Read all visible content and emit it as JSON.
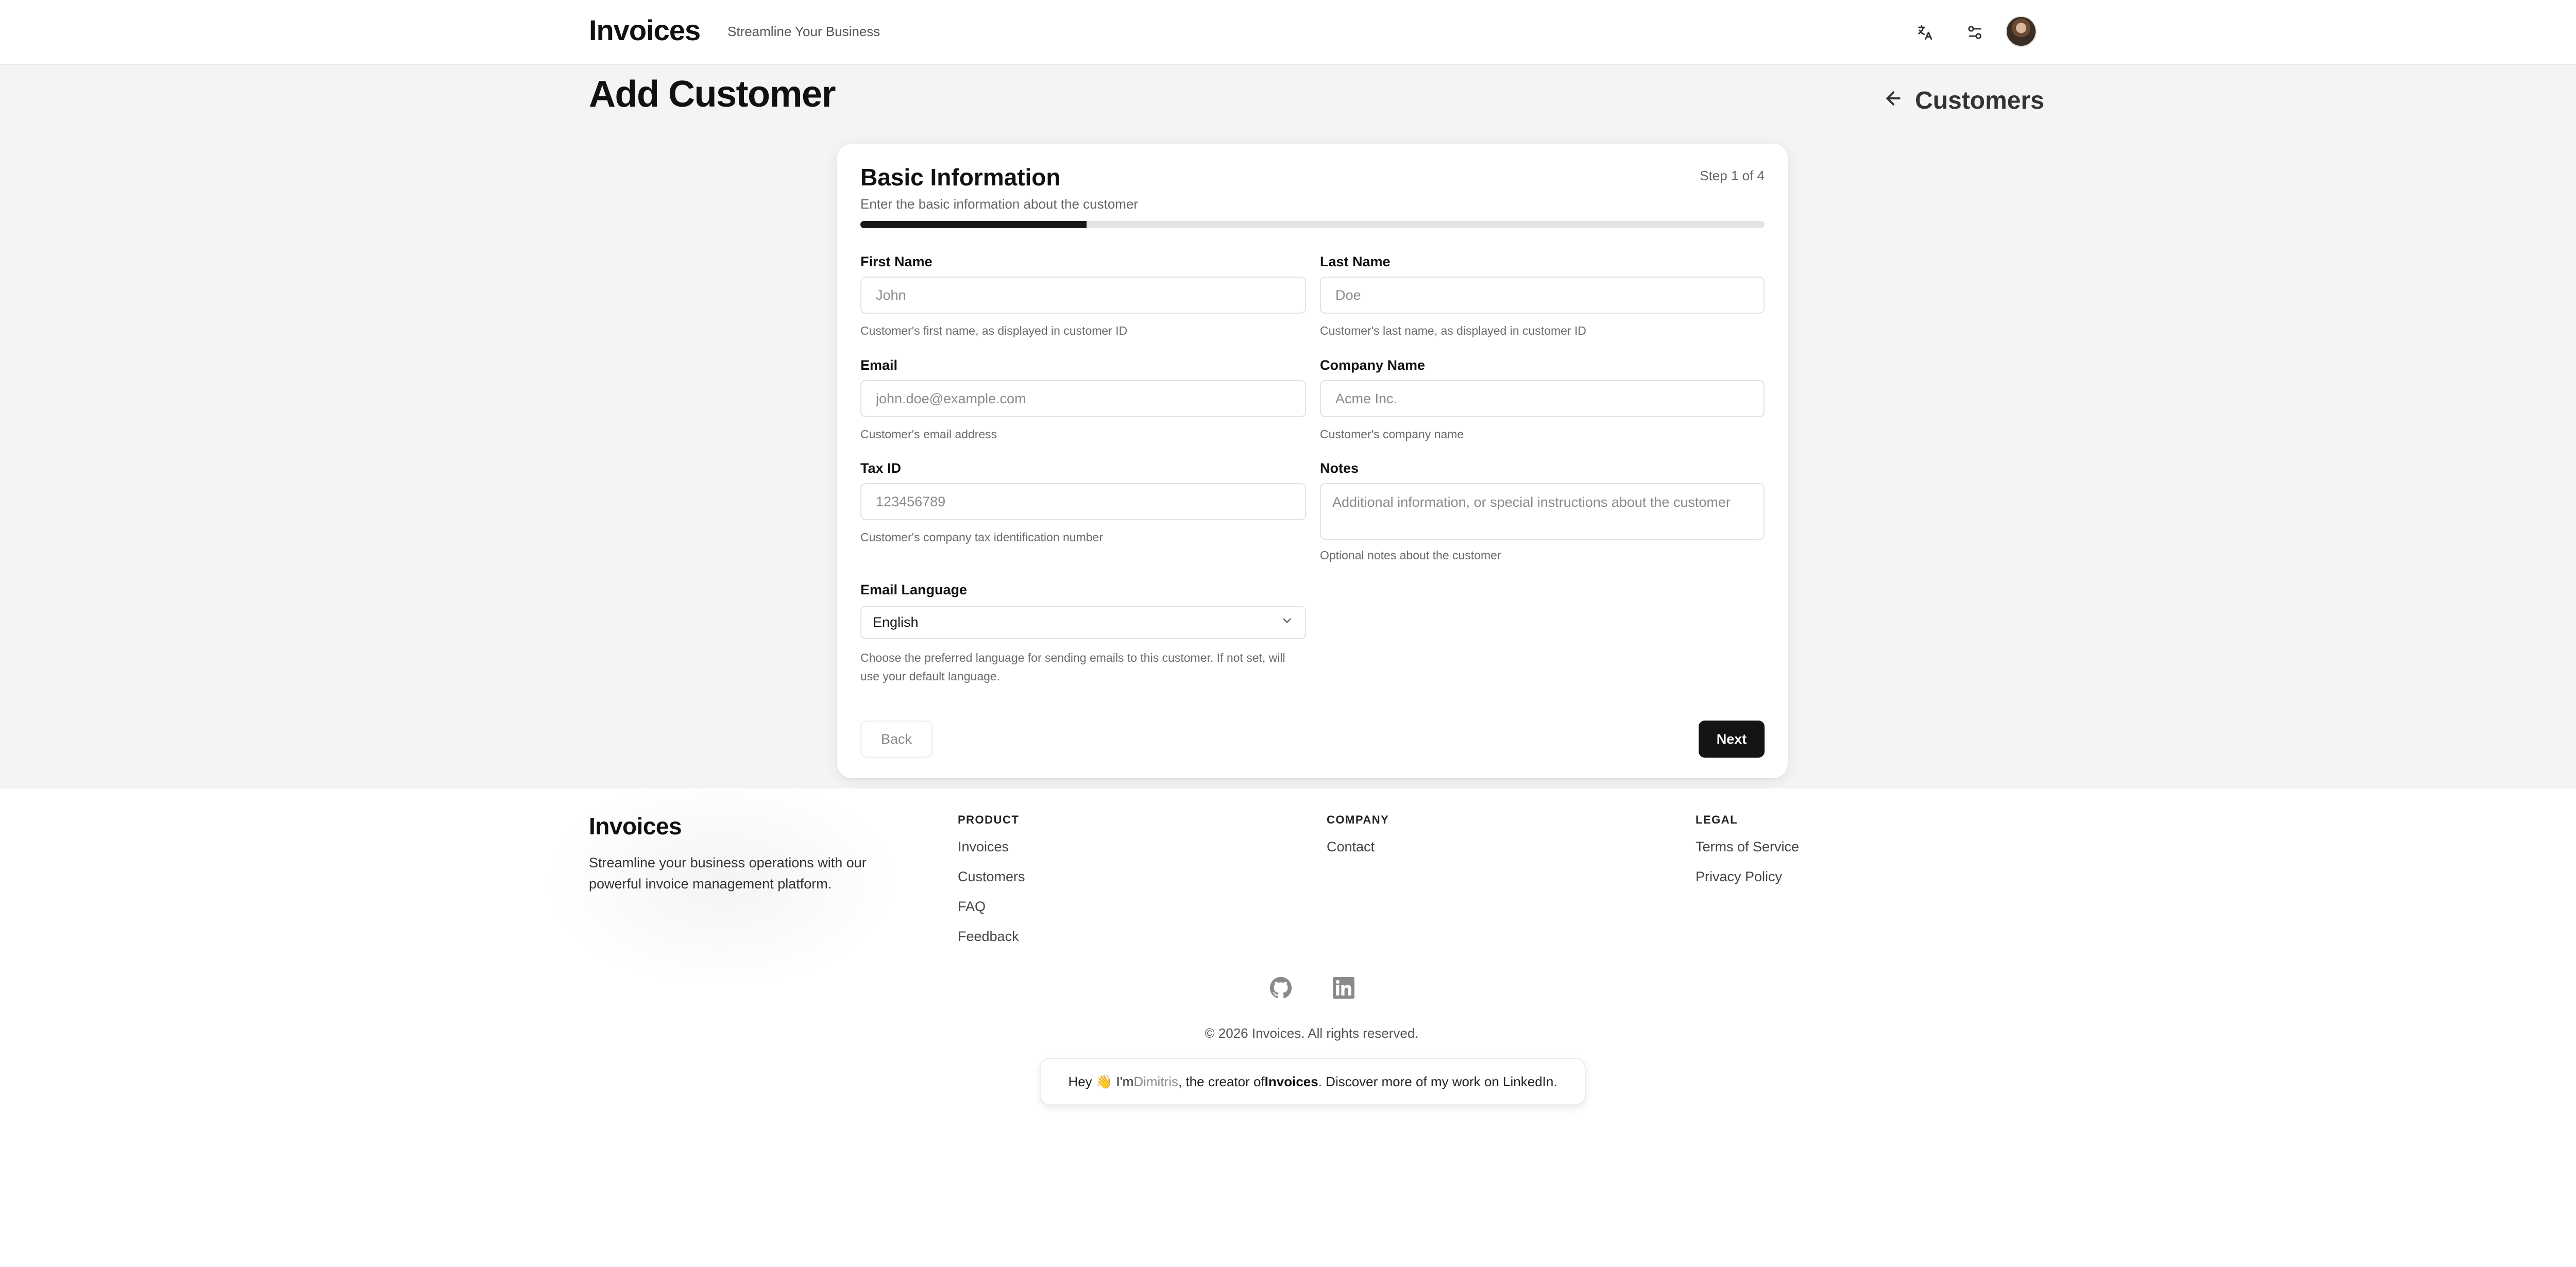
{
  "header": {
    "brand": "Invoices",
    "tagline": "Streamline Your Business",
    "icons": [
      "language-icon",
      "settings-sliders-icon"
    ],
    "avatar": "user-avatar"
  },
  "page": {
    "title": "Add Customer",
    "back_link": "Customers"
  },
  "form": {
    "title": "Basic Information",
    "step": "Step 1 of 4",
    "subtitle": "Enter the basic information about the customer",
    "progress_fraction": 0.25,
    "first_name": {
      "label": "First Name",
      "placeholder": "John",
      "hint": "Customer's first name, as displayed in customer ID"
    },
    "last_name": {
      "label": "Last Name",
      "placeholder": "Doe",
      "hint": "Customer's last name, as displayed in customer ID"
    },
    "email": {
      "label": "Email",
      "placeholder": "john.doe@example.com",
      "hint": "Customer's email address"
    },
    "company": {
      "label": "Company Name",
      "placeholder": "Acme Inc.",
      "hint": "Customer's company name"
    },
    "tax_id": {
      "label": "Tax ID",
      "placeholder": "123456789",
      "hint": "Customer's company tax identification number"
    },
    "notes": {
      "label": "Notes",
      "placeholder": "Additional information, or special instructions about the customer",
      "hint": "Optional notes about the customer"
    },
    "email_language": {
      "label": "Email Language",
      "value": "English",
      "hint": "Choose the preferred language for sending emails to this customer. If not set, will use your default language."
    },
    "back_button": "Back",
    "next_button": "Next"
  },
  "footer": {
    "brand": "Invoices",
    "description": "Streamline your business operations with our powerful invoice management platform.",
    "product": {
      "title": "PRODUCT",
      "links": [
        "Invoices",
        "Customers",
        "FAQ",
        "Feedback"
      ]
    },
    "company": {
      "title": "COMPANY",
      "links": [
        "Contact"
      ]
    },
    "legal": {
      "title": "LEGAL",
      "links": [
        "Terms of Service",
        "Privacy Policy"
      ]
    },
    "social": [
      "github-icon",
      "linkedin-icon"
    ],
    "copyright": "© 2026 Invoices. All rights reserved.",
    "creator": {
      "prefix": "Hey 👋 I'm ",
      "name": "Dimitris",
      "middle": ", the creator of ",
      "app": "Invoices",
      "suffix": ". Discover more of my work on LinkedIn."
    }
  },
  "colors": {
    "accent": "#141414",
    "page_background": "#f4f4f4",
    "progress_track": "#e4e4e4"
  }
}
